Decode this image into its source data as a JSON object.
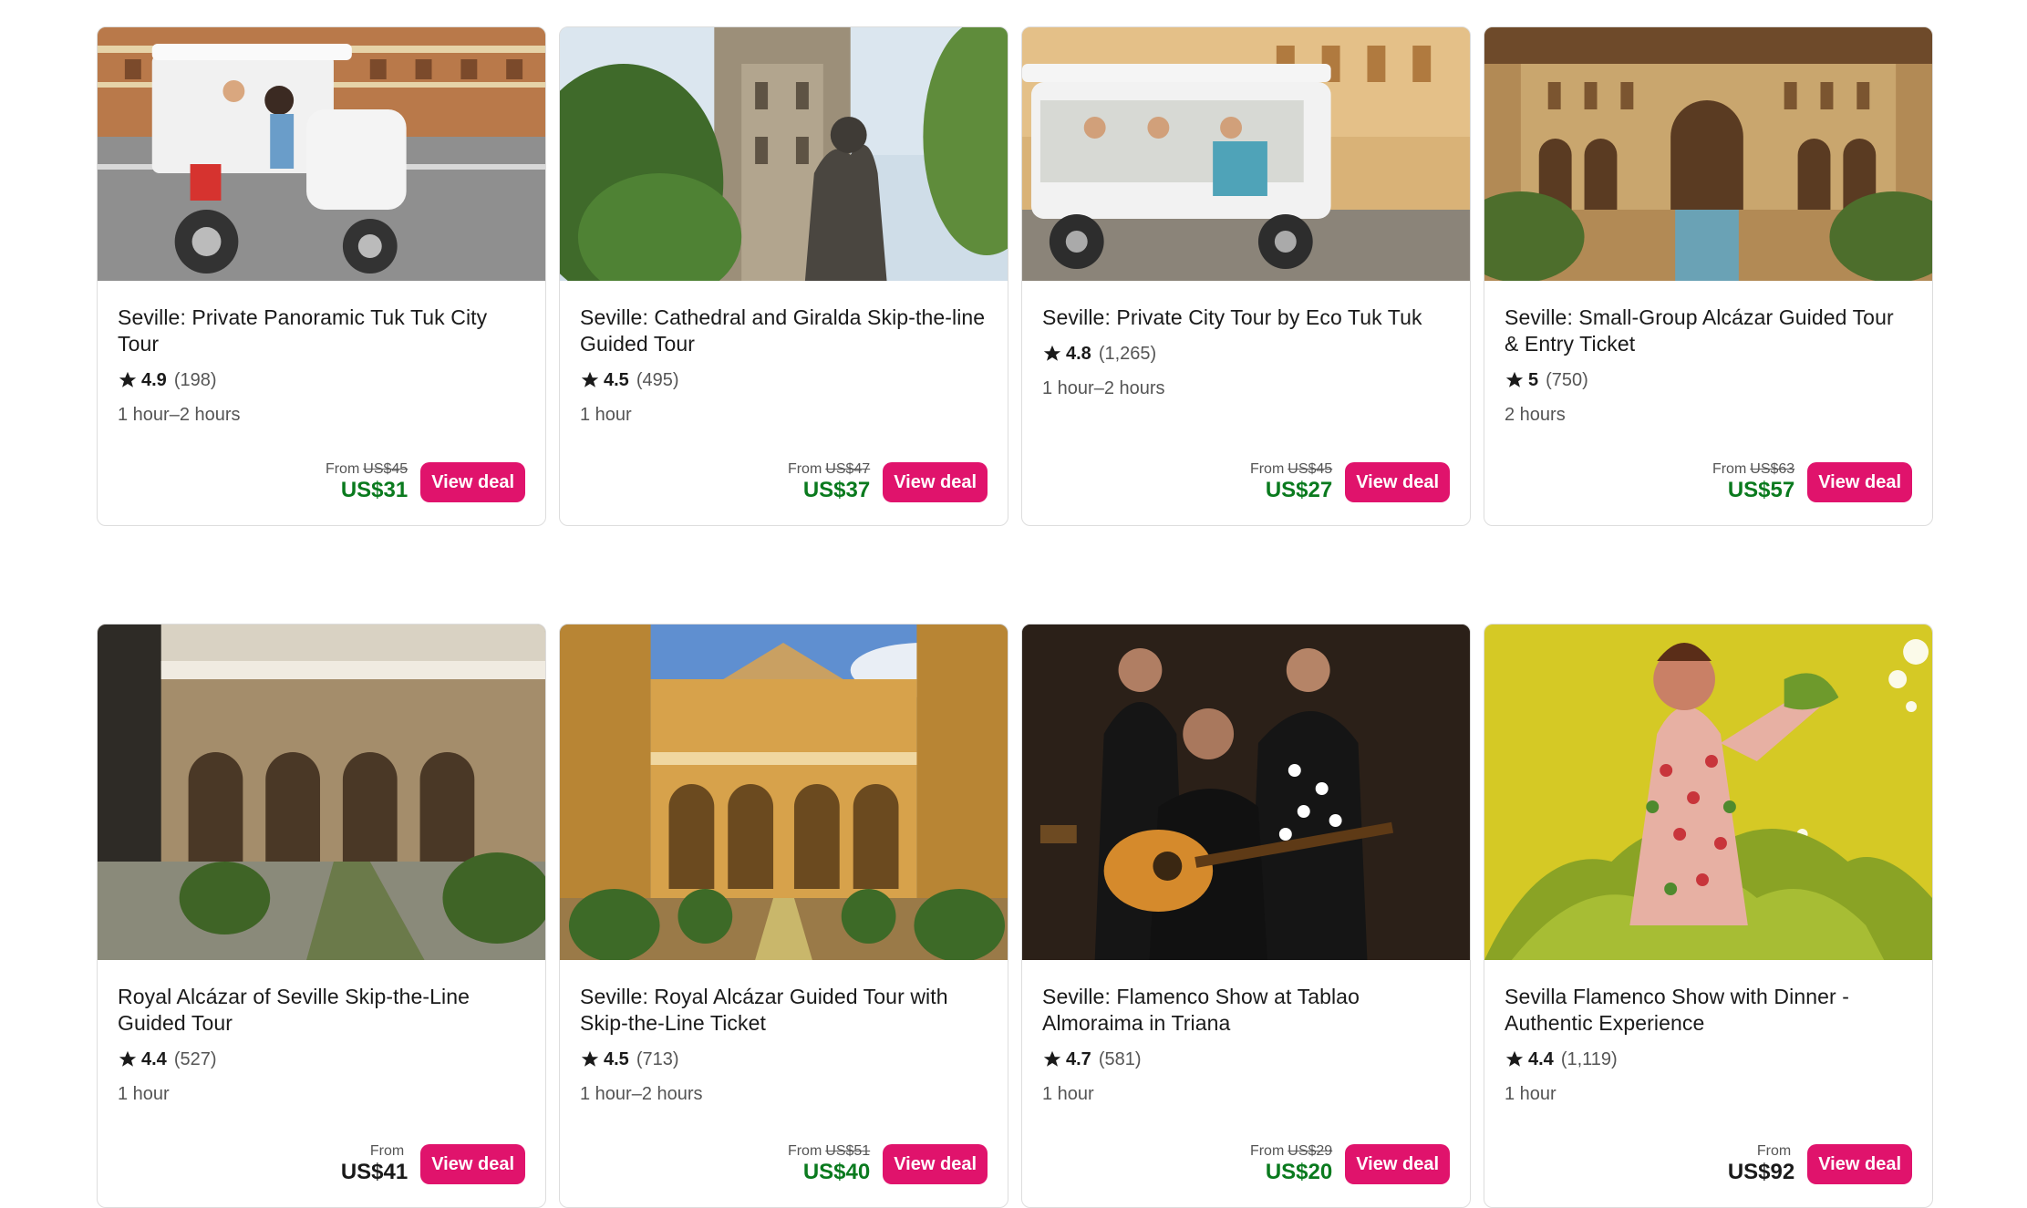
{
  "deals": [
    {
      "title": "Seville: Private Panoramic Tuk Tuk City Tour",
      "score": "4.9",
      "count": "(198)",
      "duration": "1 hour–2 hours",
      "from": "From",
      "old_price": "US$45",
      "price": "US$31",
      "sale": true,
      "button": "View deal",
      "photo": "tuk-tuk-white-street"
    },
    {
      "title": "Seville: Cathedral and Giralda Skip-the-line Guided Tour",
      "score": "4.5",
      "count": "(495)",
      "duration": "1 hour",
      "from": "From",
      "old_price": "US$47",
      "price": "US$37",
      "sale": true,
      "button": "View deal",
      "photo": "giralda-tower-statue"
    },
    {
      "title": "Seville: Private City Tour by Eco Tuk Tuk",
      "score": "4.8",
      "count": "(1,265)",
      "duration": "1 hour–2 hours",
      "from": "From",
      "old_price": "US$45",
      "price": "US$27",
      "sale": true,
      "button": "View deal",
      "photo": "eco-tuk-tuk-palace"
    },
    {
      "title": "Seville: Small-Group Alcázar Guided Tour & Entry Ticket",
      "score": "5",
      "count": "(750)",
      "duration": "2 hours",
      "from": "From",
      "old_price": "US$63",
      "price": "US$57",
      "sale": true,
      "button": "View deal",
      "photo": "alcazar-courtyard"
    },
    {
      "title": "Royal Alcázar of Seville Skip-the-Line Guided Tour",
      "score": "4.4",
      "count": "(527)",
      "duration": "1 hour",
      "from": "From",
      "old_price": "",
      "price": "US$41",
      "sale": false,
      "button": "View deal",
      "photo": "alcazar-pool-arches"
    },
    {
      "title": "Seville: Royal Alcázar Guided Tour with Skip-the-Line Ticket",
      "score": "4.5",
      "count": "(713)",
      "duration": "1 hour–2 hours",
      "from": "From",
      "old_price": "US$51",
      "price": "US$40",
      "sale": true,
      "button": "View deal",
      "photo": "alcazar-golden-courtyard"
    },
    {
      "title": "Seville: Flamenco Show at Tablao Almoraima in Triana",
      "score": "4.7",
      "count": "(581)",
      "duration": "1 hour",
      "from": "From",
      "old_price": "US$29",
      "price": "US$20",
      "sale": true,
      "button": "View deal",
      "photo": "flamenco-guitarist-dancers"
    },
    {
      "title": "Sevilla Flamenco Show with Dinner - Authentic Experience",
      "score": "4.4",
      "count": "(1,119)",
      "duration": "1 hour",
      "from": "From",
      "old_price": "",
      "price": "US$92",
      "sale": false,
      "button": "View deal",
      "photo": "flamenco-dancer-yellow"
    }
  ],
  "colors": {
    "button": "#e0136c",
    "sale_price": "#0a7a1e",
    "border": "#dddddd"
  }
}
